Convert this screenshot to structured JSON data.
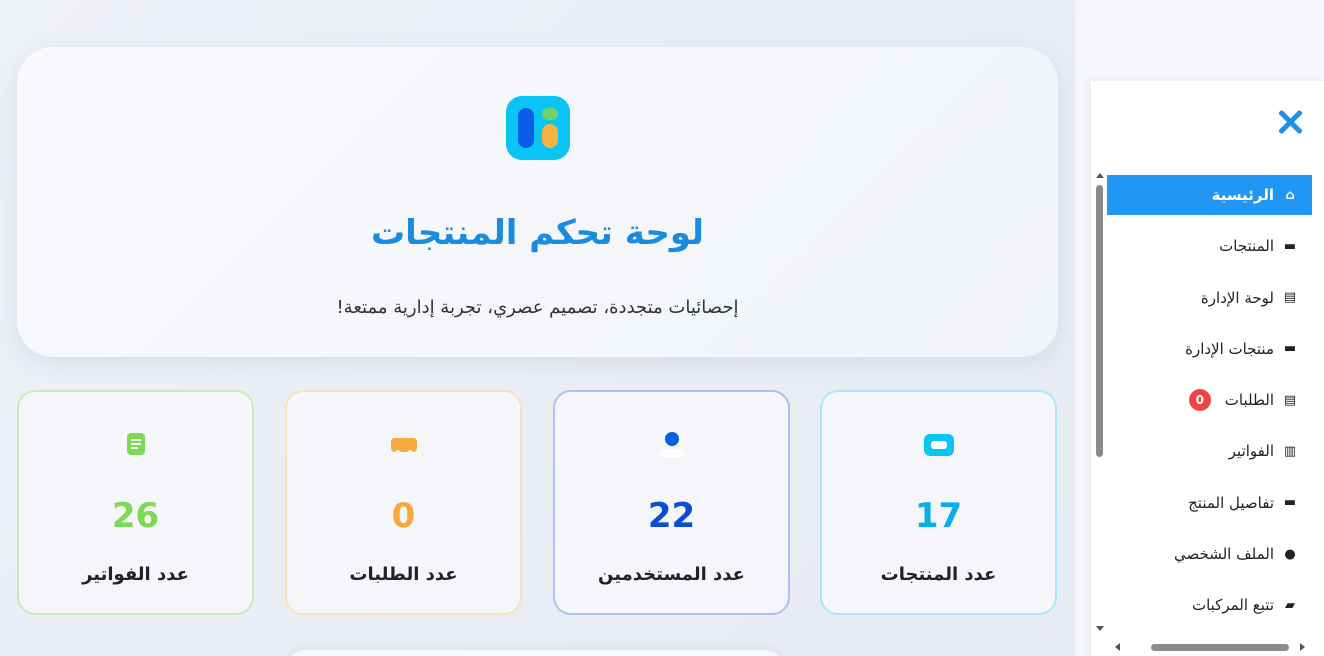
{
  "hero": {
    "title": "لوحة تحكم المنتجات",
    "subtitle": "إحصائيات متجددة، تصميم عصري، تجربة إدارية ممتعة!",
    "logo_icon": "app-logo-icon"
  },
  "stats": [
    {
      "value": "17",
      "label": "عدد المنتجات",
      "icon": "box-icon",
      "color": "#0aaee6",
      "border": "#a8e6fa"
    },
    {
      "value": "22",
      "label": "عدد المستخدمين",
      "icon": "user-icon",
      "color": "#0a4fd1",
      "border": "#a9c2f0"
    },
    {
      "value": "0",
      "label": "عدد الطلبات",
      "icon": "truck-icon",
      "color": "#f7a93a",
      "border": "#fbe0b6"
    },
    {
      "value": "26",
      "label": "عدد الفواتير",
      "icon": "invoice-icon",
      "color": "#7ed957",
      "border": "#c6ecb6"
    }
  ],
  "sidebar": {
    "close_icon": "close-icon",
    "items": [
      {
        "label": "الرئيسية",
        "icon": "home-icon",
        "glyph": "⌂"
      },
      {
        "label": "المنتجات",
        "icon": "boxes-icon",
        "glyph": "▬"
      },
      {
        "label": "لوحة الإدارة",
        "icon": "clipboard-icon",
        "glyph": "▤"
      },
      {
        "label": "منتجات الإدارة",
        "icon": "boxes-icon",
        "glyph": "▬"
      },
      {
        "label": "الطلبات",
        "icon": "clipboard-list-icon",
        "glyph": "▤",
        "badge": "0"
      },
      {
        "label": "الفواتير",
        "icon": "file-invoice-icon",
        "glyph": "▥"
      },
      {
        "label": "تفاصيل المنتج",
        "icon": "boxes-icon",
        "glyph": "▬"
      },
      {
        "label": "الملف الشخصي",
        "icon": "user-circle-icon",
        "glyph": "●"
      },
      {
        "label": "تتبع المركبات",
        "icon": "car-icon",
        "glyph": "▰"
      }
    ]
  },
  "colors": {
    "accent": "#2196f3",
    "title": "#1a8ce0",
    "badge": "#ef4444"
  }
}
